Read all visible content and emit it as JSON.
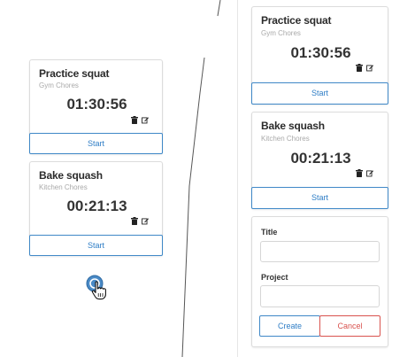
{
  "left_panel": {
    "timers": [
      {
        "title": "Practice squat",
        "project": "Gym Chores",
        "elapsed": "01:30:56",
        "start_label": "Start"
      },
      {
        "title": "Bake squash",
        "project": "Kitchen Chores",
        "elapsed": "00:21:13",
        "start_label": "Start"
      }
    ],
    "add_button_icon": "plus-circle-icon",
    "cursor_icon": "hand-pointer-icon"
  },
  "right_panel": {
    "timers": [
      {
        "title": "Practice squat",
        "project": "Gym Chores",
        "elapsed": "01:30:56",
        "start_label": "Start"
      },
      {
        "title": "Bake squash",
        "project": "Kitchen Chores",
        "elapsed": "00:21:13",
        "start_label": "Start"
      }
    ],
    "form": {
      "title_label": "Title",
      "title_value": "",
      "project_label": "Project",
      "project_value": "",
      "create_label": "Create",
      "cancel_label": "Cancel"
    }
  },
  "icons": {
    "delete": "trash-icon",
    "edit": "edit-icon"
  },
  "colors": {
    "primary": "#2f7ec6",
    "danger": "#d9534f",
    "muted": "#a9a9a9"
  }
}
